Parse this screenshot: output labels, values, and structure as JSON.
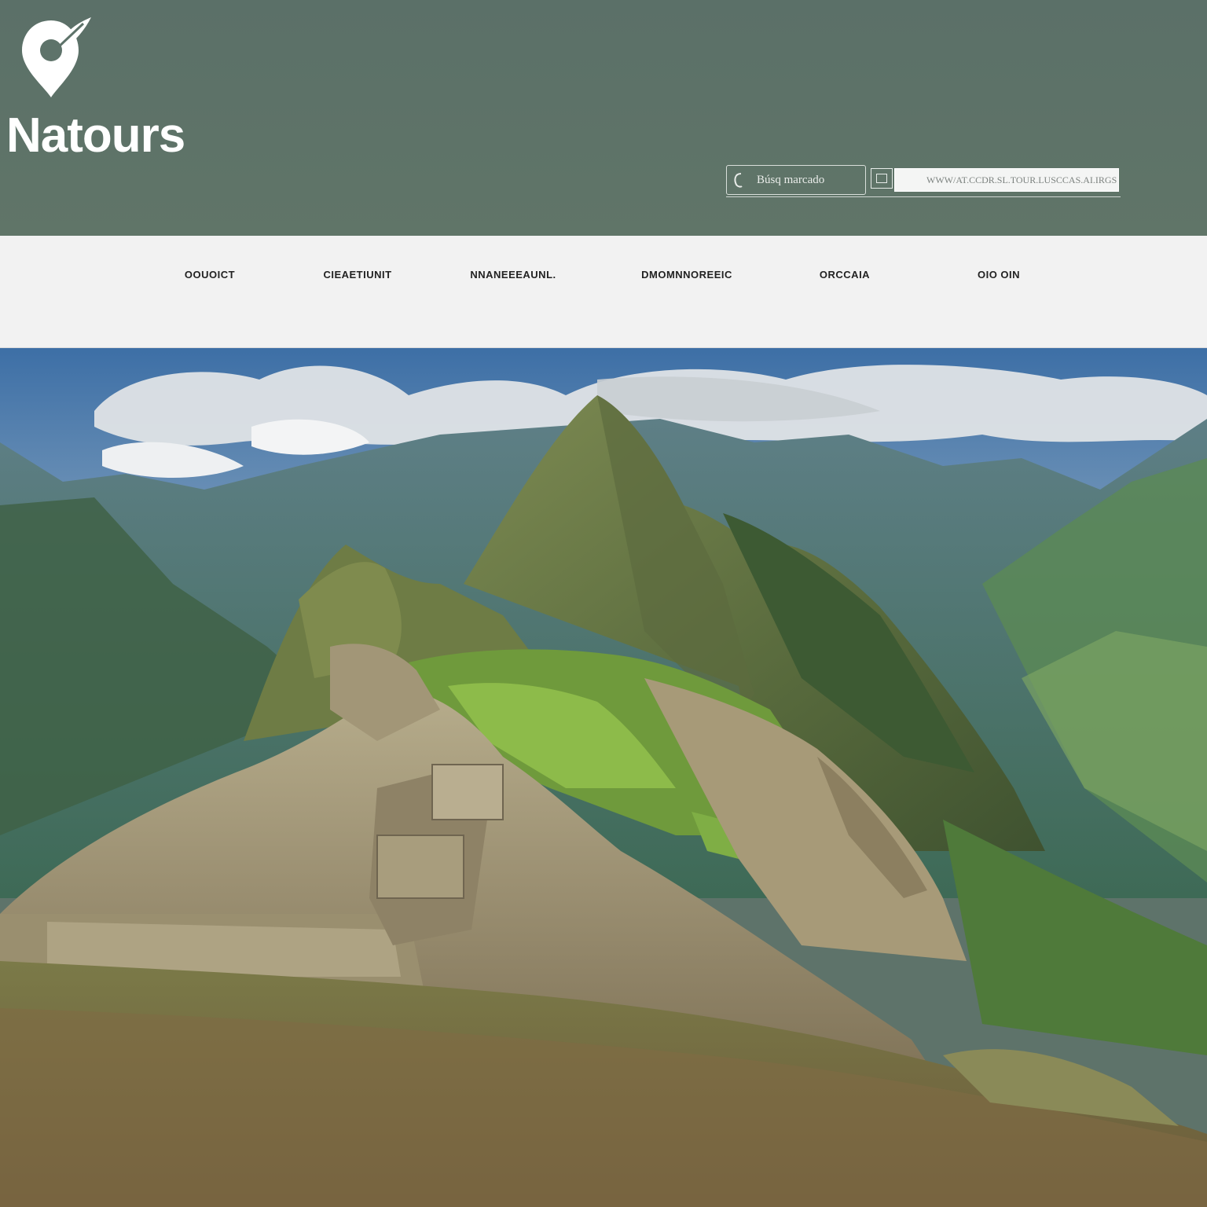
{
  "brand": {
    "name": "Natours",
    "logo_icon": "map-pin-leaf-icon",
    "header_color": "#5e736a",
    "nav_color": "#f2f2f2"
  },
  "search": {
    "icon": "search-icon",
    "text": "Búsq marcado",
    "url_bar_text": "WWW/AT.CCDR.SL.TOUR.LUSCCAS.AI.IRGS"
  },
  "nav": {
    "items": [
      {
        "label": "OOUOICT"
      },
      {
        "label": "CIEAETIUNIT"
      },
      {
        "label": "NNANEEEAUNL."
      },
      {
        "label": "DMOMNNOREEIC"
      },
      {
        "label": "ORCCAIA"
      },
      {
        "label": "OIO OIN"
      }
    ]
  }
}
